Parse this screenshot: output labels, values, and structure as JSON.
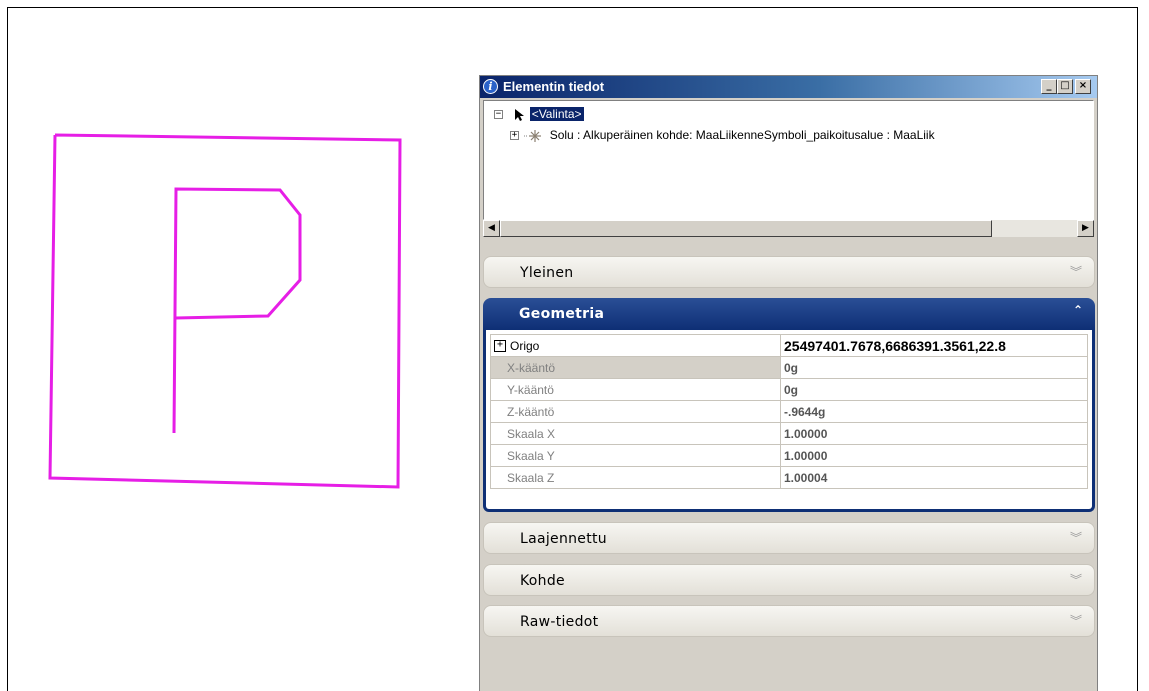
{
  "window": {
    "title": "Elementin tiedot",
    "minimize_label": "_",
    "maximize_label": "□",
    "close_label": "×"
  },
  "tree": {
    "collapse_glyph": "−",
    "expand_glyph": "+",
    "root_label": "<Valinta>",
    "child_label": "Solu : Alkuperäinen kohde: MaaLiikenneSymboli_paikoitusalue : MaaLiik"
  },
  "sections": {
    "yleinen": "Yleinen",
    "geometria": "Geometria",
    "laajennettu": "Laajennettu",
    "kohde": "Kohde",
    "raw": "Raw-tiedot"
  },
  "properties": [
    {
      "name": "Origo",
      "value": "25497401.7678,6686391.3561,22.8"
    },
    {
      "name": "X-kääntö",
      "value": "0g"
    },
    {
      "name": "Y-kääntö",
      "value": "0g"
    },
    {
      "name": "Z-kääntö",
      "value": "-.9644g"
    },
    {
      "name": "Skaala X",
      "value": "1.00000"
    },
    {
      "name": "Skaala Y",
      "value": "1.00000"
    },
    {
      "name": "Skaala Z",
      "value": "1.00004"
    }
  ],
  "drawing": {
    "stroke_color": "#e61ee6"
  }
}
